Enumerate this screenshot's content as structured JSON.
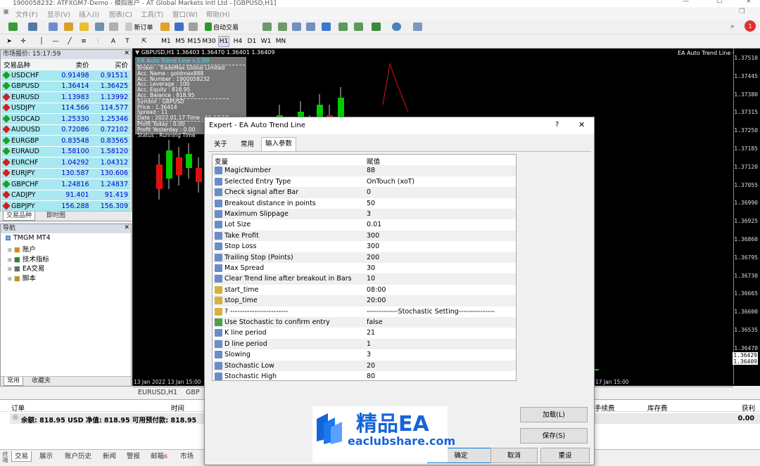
{
  "window": {
    "title": "1900058232: ATFXGM7-Demo - 模拟账户 - AT Global Markets Intl Ltd - [GBPUSD,H1]"
  },
  "menu": [
    "文件(F)",
    "显示(V)",
    "插入(I)",
    "图表(C)",
    "工具(T)",
    "窗口(W)",
    "帮助(H)"
  ],
  "toolbar": {
    "new_order": "新订单",
    "autotrade": "自动交易",
    "timeframes": [
      "M1",
      "M5",
      "M15",
      "M30",
      "H1",
      "H4",
      "D1",
      "W1",
      "MN"
    ],
    "notif_count": "1"
  },
  "market_watch": {
    "title": "市场报价: 15:17:59",
    "headers": [
      "交易品种",
      "卖价",
      "买价"
    ],
    "rows": [
      {
        "symbol": "USDCHF",
        "bid": "0.91498",
        "ask": "0.91511",
        "dir": "up"
      },
      {
        "symbol": "GBPUSD",
        "bid": "1.36414",
        "ask": "1.36425",
        "dir": "up"
      },
      {
        "symbol": "EURUSD",
        "bid": "1.13983",
        "ask": "1.13992",
        "dir": "down"
      },
      {
        "symbol": "USDJPY",
        "bid": "114.566",
        "ask": "114.577",
        "dir": "down"
      },
      {
        "symbol": "USDCAD",
        "bid": "1.25330",
        "ask": "1.25346",
        "dir": "up"
      },
      {
        "symbol": "AUDUSD",
        "bid": "0.72086",
        "ask": "0.72102",
        "dir": "down"
      },
      {
        "symbol": "EURGBP",
        "bid": "0.83548",
        "ask": "0.83565",
        "dir": "up"
      },
      {
        "symbol": "EURAUD",
        "bid": "1.58100",
        "ask": "1.58120",
        "dir": "up"
      },
      {
        "symbol": "EURCHF",
        "bid": "1.04292",
        "ask": "1.04312",
        "dir": "down"
      },
      {
        "symbol": "EURJPY",
        "bid": "130.587",
        "ask": "130.606",
        "dir": "down"
      },
      {
        "symbol": "GBPCHF",
        "bid": "1.24816",
        "ask": "1.24837",
        "dir": "up"
      },
      {
        "symbol": "CADJPY",
        "bid": "91.401",
        "ask": "91.419",
        "dir": "down"
      },
      {
        "symbol": "GBPJPY",
        "bid": "156.288",
        "ask": "156.309",
        "dir": "down"
      }
    ],
    "tabs": [
      "交易品种",
      "即时图"
    ]
  },
  "navigator": {
    "title": "导航",
    "root": "TMGM MT4",
    "items": [
      "账户",
      "技术指标",
      "EA交易",
      "脚本"
    ],
    "tabs": [
      "常用",
      "收藏夹"
    ]
  },
  "chart": {
    "header": "GBPUSD,H1  1.36403 1.36470 1.36401 1.36409",
    "ea_label": "EA Auto Trend Line",
    "prices": [
      "1.37510",
      "1.37445",
      "1.37380",
      "1.37315",
      "1.37250",
      "1.37185",
      "1.37120",
      "1.37055",
      "1.36990",
      "1.36925",
      "1.36860",
      "1.36795",
      "1.36730",
      "1.36665",
      "1.36600",
      "1.36535",
      "1.36470"
    ],
    "bid_tag": "1.36429",
    "ask_tag": "1.36409",
    "dates": [
      "13 Jan 2022",
      "13 Jan 15:00",
      "17 Jan 15:00"
    ],
    "tabs": [
      "EURUSD,H1",
      "GBP"
    ],
    "info": {
      "title": "EA Auto Trend Line v.1.00",
      "lines": [
        "Broker : TradeMax Global Limited",
        "Acc. Name : goldmax888",
        "Acc. Number : 1900058232",
        "Acc. Leverage : 100",
        "Acc. Equity : 818.95",
        "Acc. Balance : 818.95",
        "Symbol : GBPUSD",
        "Price : 1.36414",
        "Spread : 11",
        "Date : 2022.01.17  Time : 15:17:58",
        "Profit Today : 0.00",
        "Profit Yesterday : 0.00",
        "Status : Running Time"
      ]
    }
  },
  "terminal": {
    "headers": [
      "订单",
      "时间",
      "手续费",
      "库存费",
      "获利"
    ],
    "balance": "余额: 818.95 USD  净值: 818.95  可用预付款: 818.95",
    "profit": "0.00",
    "tabs": [
      "交易",
      "展示",
      "账户历史",
      "新闻",
      "警报",
      "邮箱",
      "市场"
    ],
    "mail_count": "6"
  },
  "dialog": {
    "title": "Expert - EA Auto Trend Line",
    "tabs": [
      "关于",
      "常用",
      "输入参数"
    ],
    "headers": [
      "变量",
      "赋值"
    ],
    "params": [
      {
        "icon": "int",
        "name": "MagicNumber",
        "value": "88"
      },
      {
        "icon": "enum",
        "name": "Selected Entry Type",
        "value": "OnTouch (xoT)"
      },
      {
        "icon": "int",
        "name": "Check signal after Bar",
        "value": "0"
      },
      {
        "icon": "int",
        "name": "Breakout distance in points",
        "value": "50"
      },
      {
        "icon": "int",
        "name": "Maximum Slippage",
        "value": "3"
      },
      {
        "icon": "dbl",
        "name": "Lot Size",
        "value": "0.01"
      },
      {
        "icon": "int",
        "name": "Take Profit",
        "value": "300"
      },
      {
        "icon": "int",
        "name": "Stop Loss",
        "value": "300"
      },
      {
        "icon": "int",
        "name": "Trailing Stop (Points)",
        "value": "200"
      },
      {
        "icon": "int",
        "name": "Max Spread",
        "value": "30"
      },
      {
        "icon": "int",
        "name": "Clear Trend line after breakout in Bars",
        "value": "10"
      },
      {
        "icon": "str",
        "name": "start_time",
        "value": "08:00"
      },
      {
        "icon": "str",
        "name": "stop_time",
        "value": "20:00"
      },
      {
        "icon": "str",
        "name": "? ------------------------",
        "value": "-------------Stochastic Setting---------------"
      },
      {
        "icon": "bool",
        "name": "Use Stochastic to confirm entry",
        "value": "false"
      },
      {
        "icon": "int",
        "name": "K line period",
        "value": "21"
      },
      {
        "icon": "int",
        "name": "D line period",
        "value": "1"
      },
      {
        "icon": "int",
        "name": "Slowing",
        "value": "3"
      },
      {
        "icon": "int",
        "name": "Stochastic Low",
        "value": "20"
      },
      {
        "icon": "int",
        "name": "Stochastic High",
        "value": "80"
      }
    ],
    "buttons": {
      "load": "加载(L)",
      "save": "保存(S)",
      "ok": "确定",
      "cancel": "取消",
      "reset": "重设"
    }
  },
  "watermark": {
    "title": "精品EA",
    "url": "eaclubshare.com"
  },
  "colors": {
    "chart_bg": "#000000",
    "bull": "#00cc00",
    "bear": "#e01010",
    "mw_row": "#a8e8f0",
    "info_bg": "#787878"
  }
}
